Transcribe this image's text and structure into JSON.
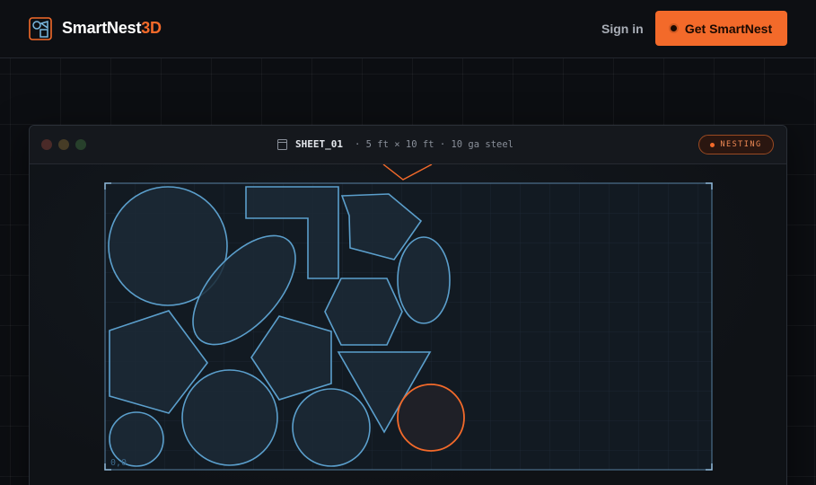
{
  "header": {
    "brand_main": "SmartNest",
    "brand_accent": "3D",
    "signin_label": "Sign in",
    "cta_label": "Get SmartNest",
    "logo_icon": "nest-logo-icon"
  },
  "window": {
    "sheet_name": "SHEET_01",
    "sheet_meta": "· 5 ft × 10 ft · 10 ga steel",
    "status_badge": "NESTING",
    "origin_label": "0,0"
  },
  "colors": {
    "accent": "#f36a2a",
    "part_stroke": "#5b9fcc",
    "part_fill": "#1c2a36",
    "background": "#0c0e12"
  }
}
